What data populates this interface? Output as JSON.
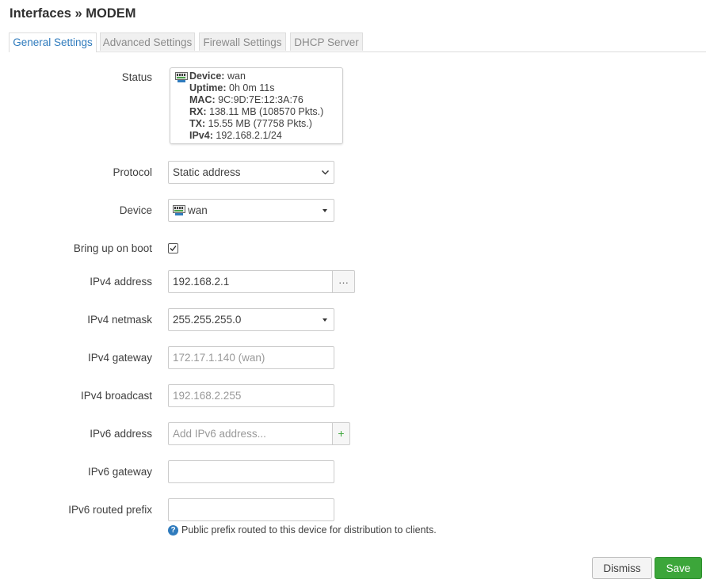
{
  "page": {
    "title": "Interfaces » MODEM"
  },
  "tabs": [
    {
      "label": "General Settings",
      "active": true
    },
    {
      "label": "Advanced Settings",
      "active": false
    },
    {
      "label": "Firewall Settings",
      "active": false
    },
    {
      "label": "DHCP Server",
      "active": false
    }
  ],
  "status": {
    "label": "Status",
    "device_key": "Device:",
    "device_val": "wan",
    "uptime_key": "Uptime:",
    "uptime_val": "0h 0m 11s",
    "mac_key": "MAC:",
    "mac_val": "9C:9D:7E:12:3A:76",
    "rx_key": "RX:",
    "rx_val": "138.11 MB (108570 Pkts.)",
    "tx_key": "TX:",
    "tx_val": "15.55 MB (77758 Pkts.)",
    "ipv4_key": "IPv4:",
    "ipv4_val": "192.168.2.1/24"
  },
  "protocol": {
    "label": "Protocol",
    "value": "Static address"
  },
  "device": {
    "label": "Device",
    "value": "wan",
    "icon": "network-port-icon"
  },
  "boot": {
    "label": "Bring up on boot",
    "checked": true
  },
  "ipv4_address": {
    "label": "IPv4 address",
    "value": "192.168.2.1",
    "button": "…"
  },
  "ipv4_netmask": {
    "label": "IPv4 netmask",
    "value": "255.255.255.0"
  },
  "ipv4_gateway": {
    "label": "IPv4 gateway",
    "placeholder": "172.17.1.140 (wan)"
  },
  "ipv4_broadcast": {
    "label": "IPv4 broadcast",
    "placeholder": "192.168.2.255"
  },
  "ipv6_address": {
    "label": "IPv6 address",
    "placeholder": "Add IPv6 address...",
    "button": "+"
  },
  "ipv6_gateway": {
    "label": "IPv6 gateway",
    "value": ""
  },
  "ipv6_prefix": {
    "label": "IPv6 routed prefix",
    "value": "",
    "hint": "Public prefix routed to this device for distribution to clients."
  },
  "actions": {
    "dismiss": "Dismiss",
    "save": "Save"
  },
  "colors": {
    "accent": "#2f7bbd",
    "save": "#3ca63a"
  }
}
